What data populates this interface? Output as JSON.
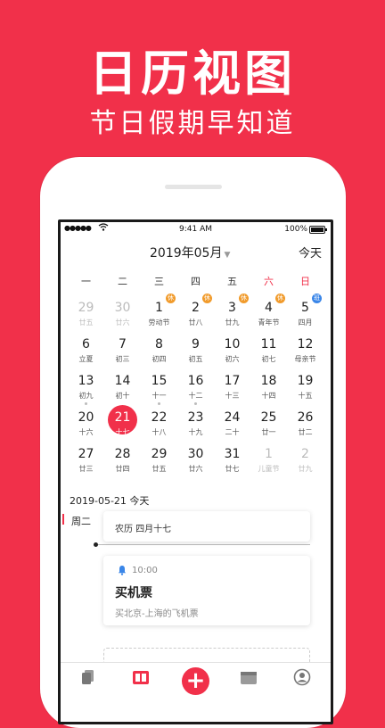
{
  "promo": {
    "title": "日历视图",
    "subtitle": "节日假期早知道"
  },
  "status_bar": {
    "signal": "●●●●●",
    "time": "9:41 AM",
    "battery": "100%"
  },
  "header": {
    "month": "2019年05月",
    "today_label": "今天"
  },
  "weekdays": [
    "一",
    "二",
    "三",
    "四",
    "五",
    "六",
    "日"
  ],
  "calendar": [
    [
      {
        "day": "29",
        "lunar": "廿五",
        "dim": true
      },
      {
        "day": "30",
        "lunar": "廿六",
        "dim": true
      },
      {
        "day": "1",
        "lunar": "劳动节",
        "badge": "休",
        "badge_color": "orange"
      },
      {
        "day": "2",
        "lunar": "廿八",
        "badge": "休",
        "badge_color": "orange"
      },
      {
        "day": "3",
        "lunar": "廿九",
        "badge": "休",
        "badge_color": "orange"
      },
      {
        "day": "4",
        "lunar": "青年节",
        "badge": "休",
        "badge_color": "orange"
      },
      {
        "day": "5",
        "lunar": "四月",
        "badge": "班",
        "badge_color": "blue"
      }
    ],
    [
      {
        "day": "6",
        "lunar": "立夏"
      },
      {
        "day": "7",
        "lunar": "初三"
      },
      {
        "day": "8",
        "lunar": "初四"
      },
      {
        "day": "9",
        "lunar": "初五"
      },
      {
        "day": "10",
        "lunar": "初六"
      },
      {
        "day": "11",
        "lunar": "初七"
      },
      {
        "day": "12",
        "lunar": "母亲节"
      }
    ],
    [
      {
        "day": "13",
        "lunar": "初九",
        "dot": true
      },
      {
        "day": "14",
        "lunar": "初十"
      },
      {
        "day": "15",
        "lunar": "十一",
        "dot": true
      },
      {
        "day": "16",
        "lunar": "十二",
        "dot": true
      },
      {
        "day": "17",
        "lunar": "十三"
      },
      {
        "day": "18",
        "lunar": "十四"
      },
      {
        "day": "19",
        "lunar": "十五"
      }
    ],
    [
      {
        "day": "20",
        "lunar": "十六"
      },
      {
        "day": "21",
        "lunar": "十七",
        "selected": true
      },
      {
        "day": "22",
        "lunar": "十八"
      },
      {
        "day": "23",
        "lunar": "十九"
      },
      {
        "day": "24",
        "lunar": "二十"
      },
      {
        "day": "25",
        "lunar": "廿一"
      },
      {
        "day": "26",
        "lunar": "廿二"
      }
    ],
    [
      {
        "day": "27",
        "lunar": "廿三"
      },
      {
        "day": "28",
        "lunar": "廿四"
      },
      {
        "day": "29",
        "lunar": "廿五"
      },
      {
        "day": "30",
        "lunar": "廿六"
      },
      {
        "day": "31",
        "lunar": "廿七"
      },
      {
        "day": "1",
        "lunar": "儿童节",
        "dim": true
      },
      {
        "day": "2",
        "lunar": "廿九",
        "dim": true
      }
    ]
  ],
  "agenda": {
    "date": "2019-05-21 今天",
    "weekday": "周二",
    "lunar_text": "农历 四月十七",
    "event": {
      "time": "10:00",
      "title": "买机票",
      "description": "买北京-上海的飞机票"
    }
  },
  "tabbar": {
    "icons": [
      "cards-icon",
      "calendar-view-icon",
      "add-icon",
      "folder-icon",
      "profile-icon"
    ],
    "add_symbol": "+"
  },
  "colors": {
    "brand": "#f1304a",
    "holiday_badge": "#f19b2c",
    "workday_badge": "#3a86e8"
  }
}
